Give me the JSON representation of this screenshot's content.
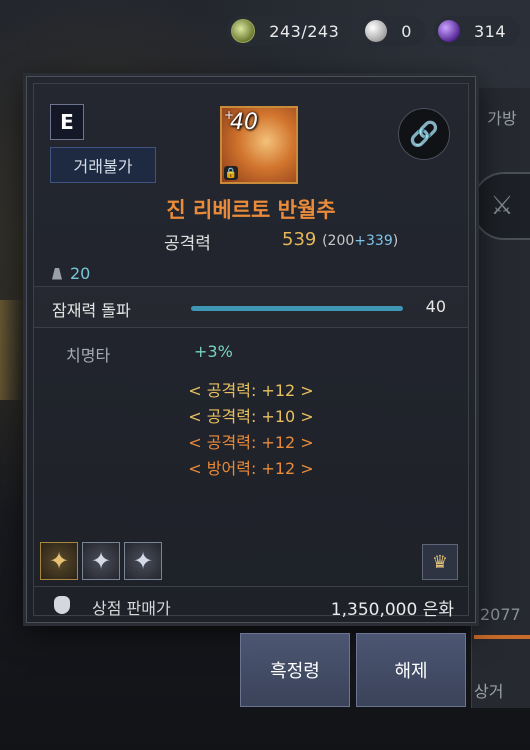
{
  "currency": {
    "energy": "243/243",
    "pearl": "0",
    "crystal": "314"
  },
  "side_panel": {
    "tab_label": "가방",
    "number": "2077",
    "bottom_label": "상거"
  },
  "item": {
    "grade": "E",
    "trade_status": "거래불가",
    "enhance_level": "40",
    "enhance_plus": "+",
    "name": "진 리베르토 반월추",
    "attack_label": "공격력",
    "attack_value": "539",
    "attack_base": "(200",
    "attack_bonus": "+339",
    "attack_close": ")",
    "weight": "20",
    "potential_label": "잠재력 돌파",
    "potential_value": "40",
    "potential_fill": 1.0,
    "crit_label": "치명타",
    "crit_value": "+3%",
    "stat_lines": [
      {
        "text": "< 공격력: +12 >",
        "color": "gold"
      },
      {
        "text": "< 공격력: +10 >",
        "color": "gold"
      },
      {
        "text": "< 공격력: +12 >",
        "color": "orange"
      },
      {
        "text": "< 방어력: +12 >",
        "color": "orange"
      }
    ],
    "gems": [
      {
        "icon": "star-gem-icon",
        "tier": "gold"
      },
      {
        "icon": "star-gem-icon",
        "tier": "silver"
      },
      {
        "icon": "star-gem-icon",
        "tier": "silver"
      }
    ],
    "sell_label": "상점 판매가",
    "sell_value": "1,350,000 은화"
  },
  "buttons": {
    "black_spirit": "흑정령",
    "release": "해제"
  },
  "colors": {
    "item_name": "#e98b3a",
    "attack_value": "#e3b75a",
    "potential_bar": "#3f97b6",
    "button": "#4c5672"
  }
}
